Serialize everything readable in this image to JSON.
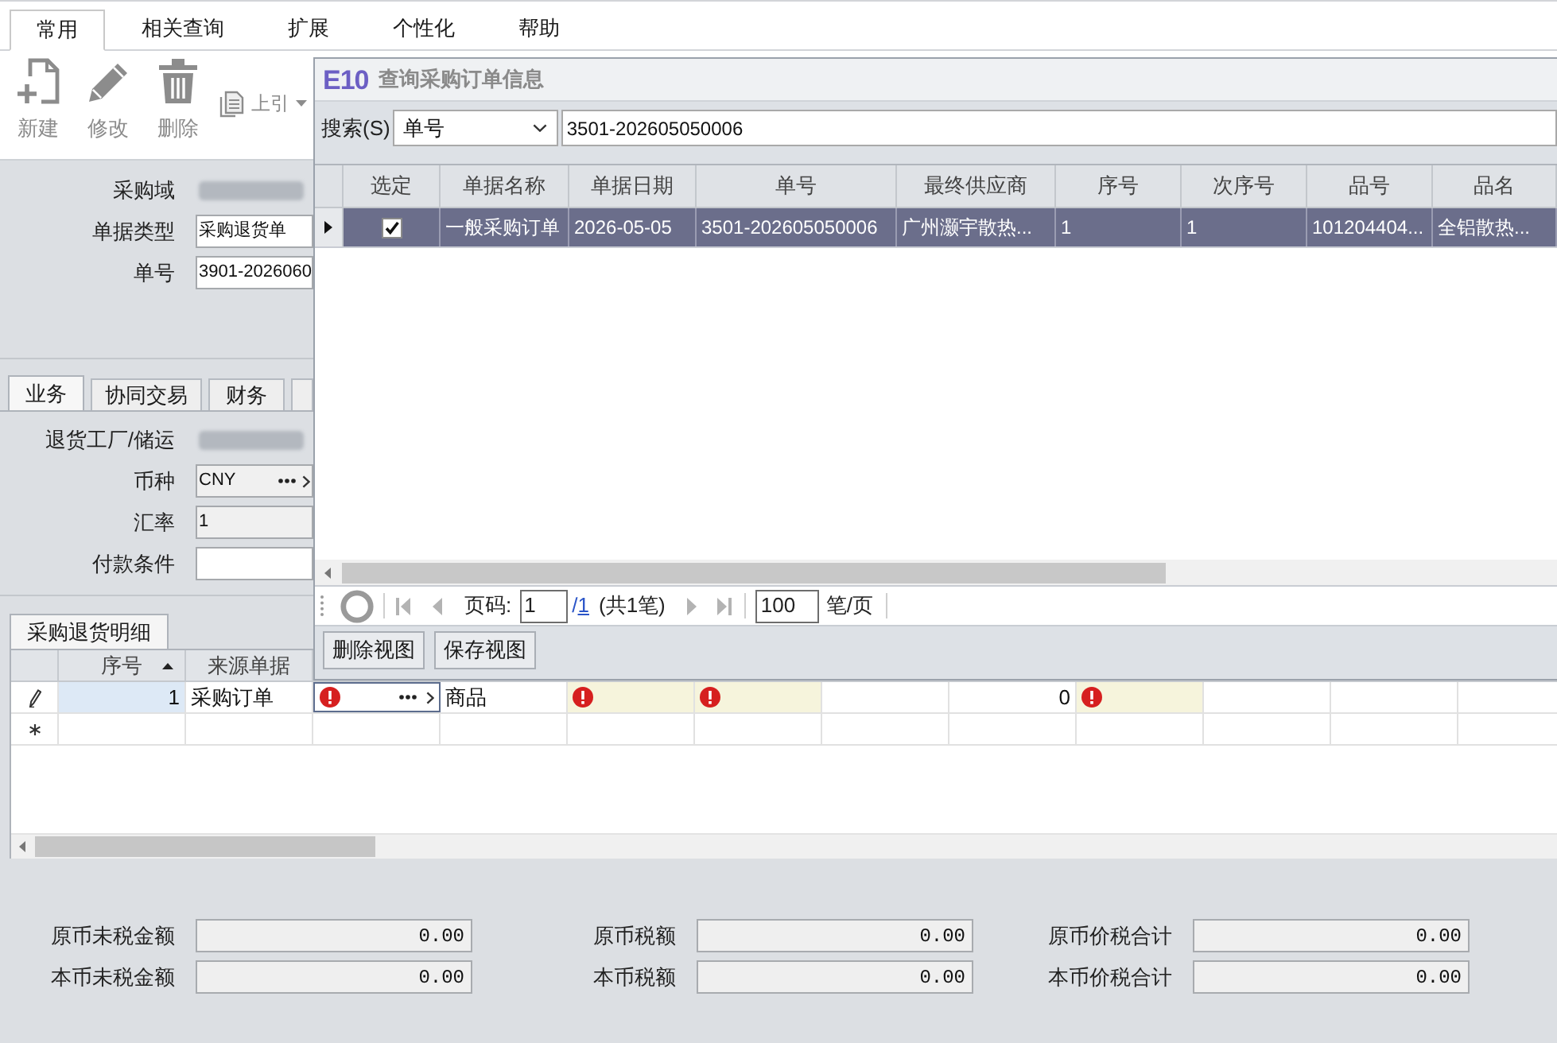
{
  "menu_tabs": [
    {
      "label": "常用",
      "selected": true
    },
    {
      "label": "相关查询",
      "selected": false
    },
    {
      "label": "扩展",
      "selected": false
    },
    {
      "label": "个性化",
      "selected": false
    },
    {
      "label": "帮助",
      "selected": false
    }
  ],
  "toolbar": [
    {
      "kind": "new",
      "label": "新建",
      "disabled": true,
      "dropdown": false
    },
    {
      "kind": "edit",
      "label": "修改",
      "disabled": true,
      "dropdown": false
    },
    {
      "kind": "delete",
      "label": "删除",
      "disabled": true,
      "dropdown": false
    },
    {
      "kind": "reference",
      "label": "上引",
      "disabled": true,
      "dropdown": true
    }
  ],
  "header_form": [
    {
      "label": "采购域",
      "kind": "redacted"
    },
    {
      "label": "单据类型",
      "kind": "text",
      "value": "采购退货单",
      "readonly": false
    },
    {
      "label": "单号",
      "kind": "text",
      "value": "3901-2026060",
      "readonly": false
    }
  ],
  "section_tabs": [
    {
      "label": "业务",
      "selected": true
    },
    {
      "label": "协同交易",
      "selected": false
    },
    {
      "label": "财务",
      "selected": false
    },
    {
      "selected": false
    }
  ],
  "business_form": [
    {
      "label": "退货工厂/储运",
      "kind": "redacted"
    },
    {
      "label": "币种",
      "kind": "picker",
      "value": "CNY",
      "readonly": true
    },
    {
      "label": "汇率",
      "kind": "text",
      "value": "1",
      "readonly": true
    },
    {
      "label": "付款条件",
      "kind": "text",
      "readonly": false
    }
  ],
  "lines": {
    "tab": {
      "label": "采购退货明细",
      "selected": true
    },
    "columns": [
      {
        "label": "序号",
        "sorted": true
      },
      {
        "label": "来源单据",
        "sorted": false
      }
    ],
    "rows": [
      {
        "kind": "editing",
        "cells": [
          {
            "kind": "number",
            "text": "1",
            "error": false,
            "required": false,
            "focused": false,
            "highlighted": true
          },
          {
            "kind": "text",
            "text": "采购订单",
            "error": false,
            "required": false,
            "focused": false,
            "highlighted": false
          },
          {
            "kind": "picker",
            "error": true,
            "required": false,
            "focused": true,
            "highlighted": false
          },
          {
            "kind": "text",
            "text": "商品",
            "error": false,
            "required": false,
            "focused": false,
            "highlighted": false
          },
          {
            "kind": "text",
            "error": true,
            "required": true,
            "focused": false,
            "highlighted": false
          },
          {
            "kind": "text",
            "error": true,
            "required": true,
            "focused": false,
            "highlighted": false
          },
          {
            "kind": "text",
            "error": false,
            "required": false,
            "focused": false,
            "highlighted": false
          },
          {
            "kind": "number",
            "text": "0",
            "error": false,
            "required": false,
            "focused": false,
            "highlighted": false
          },
          {
            "kind": "text",
            "error": true,
            "required": true,
            "focused": false,
            "highlighted": false
          },
          {
            "kind": "text",
            "error": false,
            "required": false,
            "focused": false,
            "highlighted": false
          },
          {
            "kind": "text",
            "error": false,
            "required": false,
            "focused": false,
            "highlighted": false
          }
        ]
      },
      {
        "kind": "new"
      }
    ]
  },
  "totals": [
    {
      "label": "原币未税金额",
      "value": "0.00"
    },
    {
      "label": "原币税额",
      "value": "0.00"
    },
    {
      "label": "原币价税合计",
      "value": "0.00"
    },
    {
      "label": "本币未税金额",
      "value": "0.00"
    },
    {
      "label": "本币税额",
      "value": "0.00"
    },
    {
      "label": "本币价税合计",
      "value": "0.00"
    }
  ],
  "dialog": {
    "logo": "E10",
    "title": "查询采购订单信息",
    "search": {
      "label": "搜索(S)",
      "field": "单号",
      "value": "3501-202605050006"
    },
    "columns": [
      {
        "label": "选定",
        "kind": "checkbox"
      },
      {
        "label": "单据名称",
        "kind": "text"
      },
      {
        "label": "单据日期",
        "kind": "text"
      },
      {
        "label": "单号",
        "kind": "text"
      },
      {
        "label": "最终供应商",
        "kind": "text"
      },
      {
        "label": "序号",
        "kind": "text"
      },
      {
        "label": "次序号",
        "kind": "text"
      },
      {
        "label": "品号",
        "kind": "text"
      },
      {
        "label": "品名",
        "kind": "text"
      }
    ],
    "rows": [
      {
        "selected": true,
        "current": true,
        "checked": true,
        "cells": [
          "",
          "一般采购订单",
          "2026-05-05",
          "3501-202605050006",
          "广州灏宇散热...",
          "1",
          "1",
          "101204404...",
          "全铝散热..."
        ]
      }
    ],
    "pager": {
      "page_label": "页码:",
      "page": "1",
      "of": "/",
      "total_pages": "1",
      "count": "(共1笔)",
      "page_size": "100",
      "page_size_unit": "笔/页"
    },
    "buttons": [
      "删除视图",
      "保存视图"
    ]
  }
}
